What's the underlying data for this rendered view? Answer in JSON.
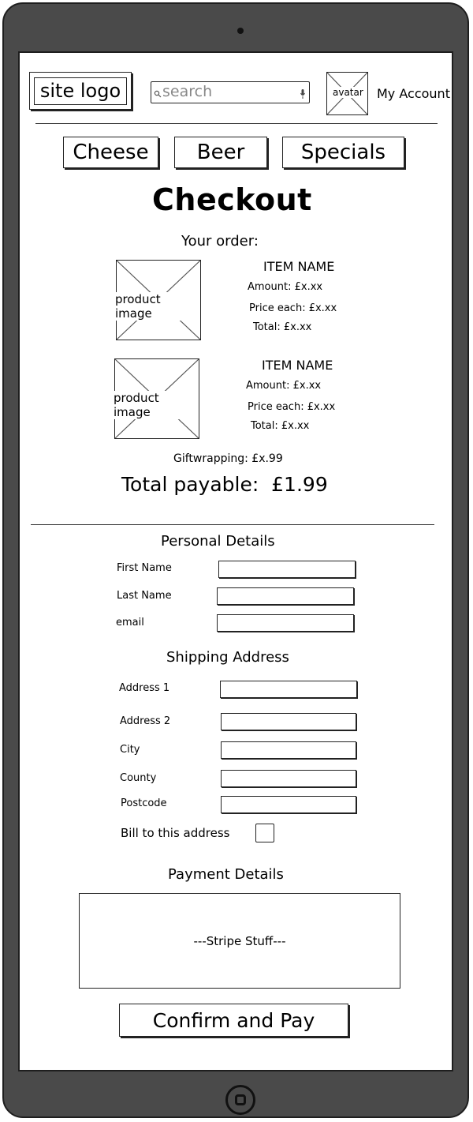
{
  "header": {
    "logo": "site logo",
    "search_placeholder": "search",
    "avatar": "avatar",
    "account": "My Account"
  },
  "nav": {
    "cheese": "Cheese",
    "beer": "Beer",
    "specials": "Specials"
  },
  "page": {
    "title": "Checkout"
  },
  "order": {
    "heading": "Your order:",
    "items": [
      {
        "image_label": "product image",
        "name": "ITEM NAME",
        "amount": "Amount: £x.xx",
        "price_each": "Price each: £x.xx",
        "total": "Total: £x.xx"
      },
      {
        "image_label": "product image",
        "name": "ITEM NAME",
        "amount": "Amount: £x.xx",
        "price_each": "Price each: £x.xx",
        "total": "Total: £x.xx"
      }
    ],
    "giftwrapping": "Giftwrapping: £x.99",
    "total_payable": "Total payable:  £1.99"
  },
  "personal": {
    "heading": "Personal Details",
    "first_name": "First Name",
    "last_name": "Last Name",
    "email": "email"
  },
  "shipping": {
    "heading": "Shipping Address",
    "address1": "Address 1",
    "address2": "Address 2",
    "city": "City",
    "county": "County",
    "postcode": "Postcode",
    "bill_label": "Bill to this address"
  },
  "payment": {
    "heading": "Payment Details",
    "stripe": "---Stripe Stuff---"
  },
  "actions": {
    "confirm": "Confirm and Pay"
  },
  "icons": {
    "search": "search-icon",
    "mic": "microphone-icon",
    "home": "home-button-icon",
    "camera": "camera-icon"
  },
  "colors": {
    "device_frame": "#4a4a4a",
    "screen": "#ffffff",
    "ink": "#222222"
  }
}
